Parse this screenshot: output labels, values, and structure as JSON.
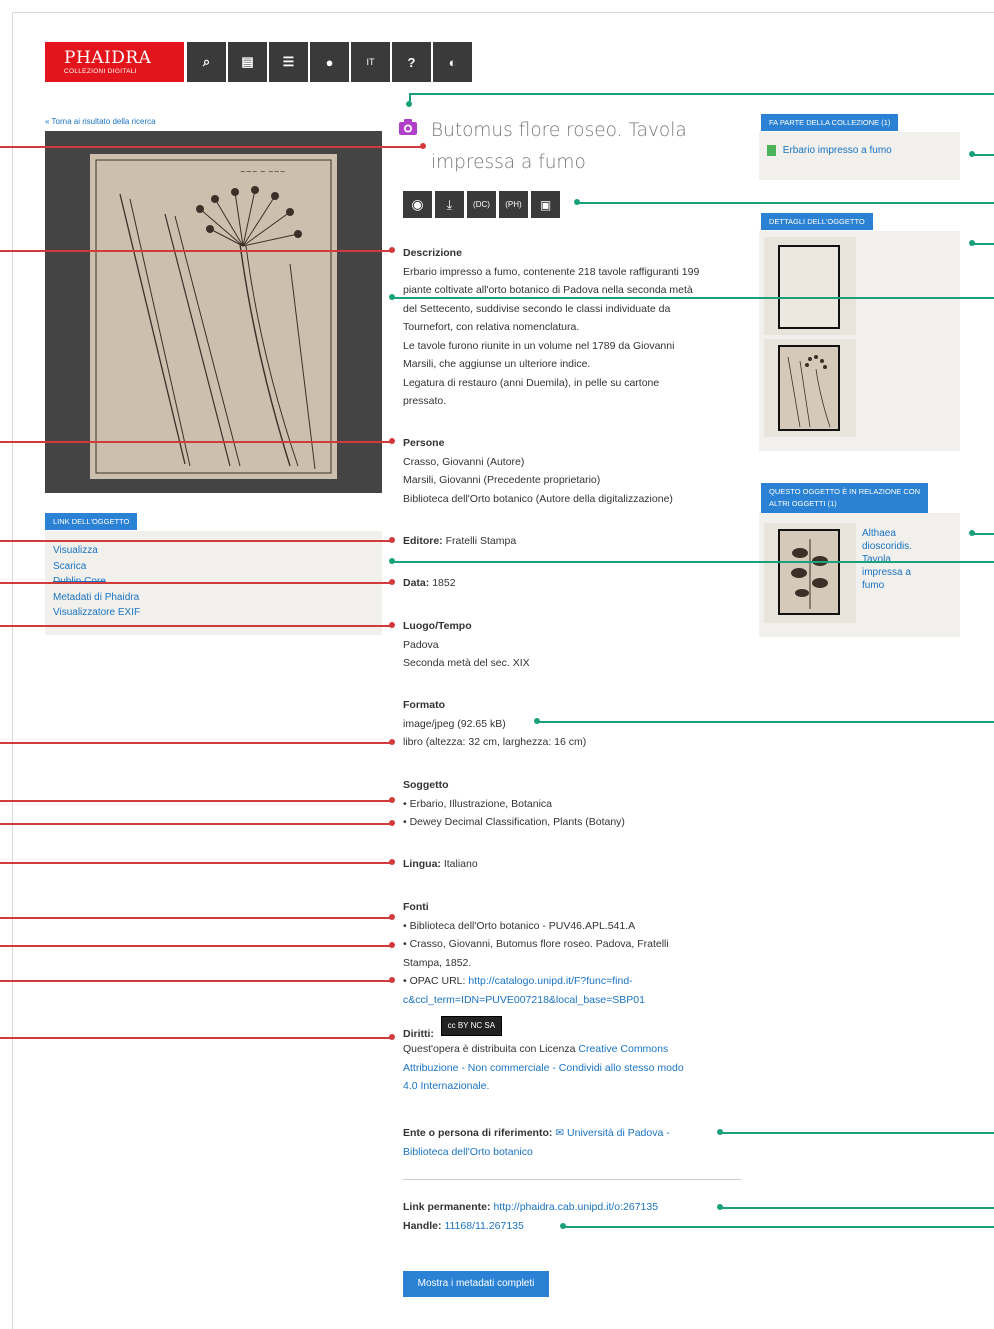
{
  "header": {
    "logo_title": "PHAIDRA",
    "logo_subtitle": "COLLEZIONI DIGITALI",
    "nav": [
      {
        "label": "⌕",
        "icon": "search-icon"
      },
      {
        "label": "▤",
        "icon": "browse-icon"
      },
      {
        "label": "☰",
        "icon": "list-icon"
      },
      {
        "label": "●",
        "icon": "user-icon"
      },
      {
        "label": "IT",
        "icon": "language-icon"
      },
      {
        "label": "?",
        "icon": "help-icon"
      },
      {
        "label": "◐",
        "icon": "contrast-icon"
      }
    ]
  },
  "left": {
    "back_link": "« Torna ai risultato della ricerca",
    "links_label": "LINK DELL'OGGETTO",
    "links": [
      "Visualizza",
      "Scarica",
      "Dublin Core",
      "Metadati di Phaidra",
      "Visualizzatore EXIF"
    ]
  },
  "object": {
    "title": "Butomus flore roseo. Tavola impressa a fumo",
    "actions": [
      {
        "label": "◉",
        "icon": "view-icon"
      },
      {
        "label": "⤓",
        "icon": "download-icon"
      },
      {
        "label": "(DC)",
        "icon": "dublin-core-icon"
      },
      {
        "label": "(PH)",
        "icon": "phaidra-metadata-icon"
      },
      {
        "label": "▣",
        "icon": "exif-icon"
      }
    ],
    "descrizione_label": "Descrizione",
    "descrizione": [
      "Erbario impresso a fumo, contenente 218 tavole raffiguranti 199",
      "piante coltivate all'orto botanico di Padova nella seconda metà",
      "del Settecento, suddivise secondo le classi individuate da",
      "Tournefort, con relativa nomenclatura.",
      "Le tavole furono riunite in un volume nel 1789 da Giovanni",
      "Marsili, che aggiunse un ulteriore indice.",
      "Legatura di restauro (anni Duemila), in pelle su cartone",
      "pressato."
    ],
    "persone_label": "Persone",
    "persone": [
      "Crasso, Giovanni (Autore)",
      "Marsili, Giovanni (Precedente proprietario)",
      "Biblioteca dell'Orto botanico (Autore della digitalizzazione)"
    ],
    "editore_label": "Editore:",
    "editore": "Fratelli Stampa",
    "data_label": "Data:",
    "data": "1852",
    "luogo_label": "Luogo/Tempo",
    "luogo": [
      "Padova",
      "Seconda metà del sec. XIX"
    ],
    "formato_label": "Formato",
    "formato": [
      "image/jpeg (92.65 kB)",
      "libro (altezza: 32 cm, larghezza: 16 cm)"
    ],
    "soggetto_label": "Soggetto",
    "soggetto": [
      "• Erbario, Illustrazione, Botanica",
      "• Dewey Decimal Classification, Plants (Botany)"
    ],
    "lingua_label": "Lingua:",
    "lingua": "Italiano",
    "fonti_label": "Fonti",
    "fonti_1": "• Biblioteca dell'Orto botanico - PUV46.APL.541.A",
    "fonti_2a": "• Crasso, Giovanni, Butomus flore roseo. Padova, Fratelli",
    "fonti_2b": "Stampa, 1852.",
    "fonti_3_prefix": "• OPAC URL:",
    "fonti_3_link_a": "http://catalogo.unipd.it/F?func=find-",
    "fonti_3_link_b": "c&ccl_term=IDN=PUVE007218&local_base=SBP01",
    "diritti_label": "Diritti:",
    "cc_badge": "cc BY NC SA",
    "diritti_text": "Quest'opera è distribuita con Licenza",
    "diritti_link_a": "Creative Commons",
    "diritti_link_b": "Attribuzione - Non commerciale - Condividi allo stesso modo",
    "diritti_link_c": "4.0 Internazionale.",
    "ente_label": "Ente o persona di riferimento:",
    "ente_link_a": "Università di Padova -",
    "ente_link_b": "Biblioteca dell'Orto botanico",
    "permalink_label": "Link permanente:",
    "permalink": "http://phaidra.cab.unipd.it/o:267135",
    "handle_label": "Handle:",
    "handle": "11168/11.267135",
    "show_all_button": "Mostra i metadati completi"
  },
  "right": {
    "collection_label": "FA PARTE DELLA COLLEZIONE (1)",
    "collection_link": "Erbario impresso a fumo",
    "details_label": "DETTAGLI DELL'OGGETTO",
    "related_label_a": "QUESTO OGGETTO È IN RELAZIONE CON",
    "related_label_b": "ALTRI OGGETTI (1)",
    "related_link": "Althaea dioscoridis. Tavola impressa a fumo"
  },
  "colors": {
    "brand_red": "#e3141b",
    "link_blue": "#1a73c2",
    "label_blue": "#2b82d4",
    "annotation_red": "#d23b3b",
    "annotation_green": "#1aa07a",
    "dark_button": "#3a3a3a"
  }
}
